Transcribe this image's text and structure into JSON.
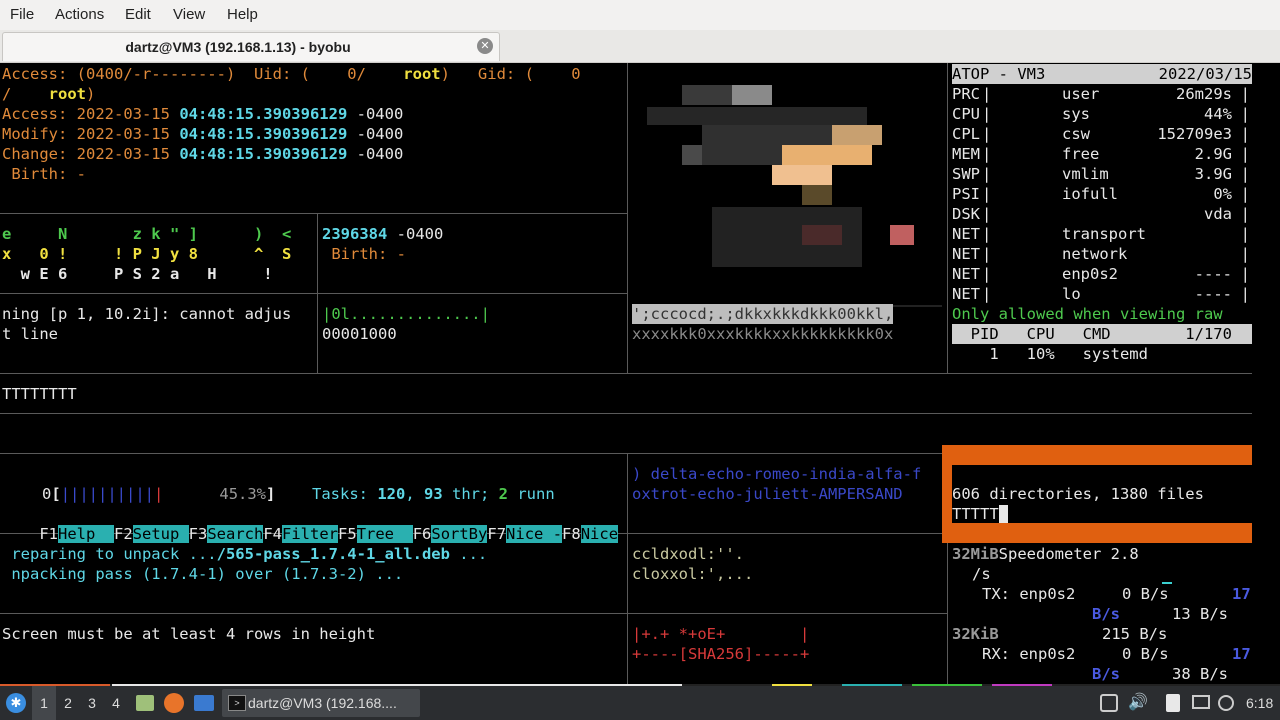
{
  "menubar": [
    "File",
    "Actions",
    "Edit",
    "View",
    "Help"
  ],
  "tab": {
    "title": "dartz@VM3 (192.168.1.13) - byobu"
  },
  "stat": {
    "access_perm": "Access: (0400/-r--------)  Uid: (    0/    ",
    "root1": "root",
    "gid": ")   Gid: (    0",
    "slash": "/    ",
    "root2": "root",
    "close": ")",
    "access_label": "Access: 2022-03-15 ",
    "access_time": "04:48:15.390396129",
    "access_tz": " -0400",
    "modify_label": "Modify: 2022-03-15 ",
    "modify_time": "04:48:15.390396129",
    "modify_tz": " -0400",
    "change_label": "Change: 2022-03-15 ",
    "change_time": "04:48:15.390396129",
    "change_tz": " -0400",
    "birth": " Birth: -"
  },
  "glyphs": {
    "l1": "e     N       z k \" ]      )  <",
    "l2": "x   0 !     ! P J y 8      ^  S",
    "l3": "  w E 6     P S 2 a   H     !"
  },
  "stat2": {
    "time": "2396384",
    "tz": " -0400",
    "birth": " Birth: -"
  },
  "apt_err": {
    "l1": "ning [p 1, 10.2i]: cannot adjus",
    "l2": "t line"
  },
  "hexdump": {
    "l1": "|0l..............|",
    "l2": "00001000"
  },
  "art": {
    "l1": "';cccocd;.;dkkxkkkdkkk00kkl,",
    "l2": "xxxxkkk0xxxkkkkxxkkkkkkkkk0x"
  },
  "atop": {
    "header_name": "ATOP - VM3",
    "header_date": "2022/03/15",
    "rows": [
      {
        "k": "PRC",
        "label": "user",
        "value": "26m29s"
      },
      {
        "k": "CPU",
        "label": "sys",
        "value": "44%"
      },
      {
        "k": "CPL",
        "label": "csw",
        "value": "152709e3"
      },
      {
        "k": "MEM",
        "label": "free",
        "value": "2.9G"
      },
      {
        "k": "SWP",
        "label": "vmlim",
        "value": "3.9G"
      },
      {
        "k": "PSI",
        "label": "iofull",
        "value": "0%"
      },
      {
        "k": "DSK",
        "label": "",
        "value": "vda"
      },
      {
        "k": "NET",
        "label": "transport",
        "value": ""
      },
      {
        "k": "NET",
        "label": "network",
        "value": ""
      },
      {
        "k": "NET",
        "label": "enp0s2",
        "value": "----"
      },
      {
        "k": "NET",
        "label": "lo",
        "value": "----"
      }
    ],
    "note": "Only allowed when viewing raw",
    "proc_header": "  PID   CPU   CMD        1/170",
    "proc_row": "    1   10%   systemd"
  },
  "tline": "TTTTTTTT",
  "htop": {
    "cpu_label": "0",
    "cpu_open": "[",
    "cpu_bars": "||||||||||",
    "cpu_pct": "45.3%",
    "cpu_close": "]",
    "tasks_label": "Tasks: ",
    "tasks": "120",
    ", ": ", ",
    "thr": "93",
    " thr; ": " thr; ",
    "run": "2",
    " runn": " runn",
    "fkeys": [
      [
        "F1",
        "Help  "
      ],
      [
        "F2",
        "Setup "
      ],
      [
        "F3",
        "Search"
      ],
      [
        "F4",
        "Filter"
      ],
      [
        "F5",
        "Tree  "
      ],
      [
        "F6",
        "SortBy"
      ],
      [
        "F7",
        "Nice -"
      ],
      [
        "F8",
        "Nice"
      ]
    ]
  },
  "apt": {
    "l1a": " reparing to unpack ...",
    "l1b": "/565-pass_1.7.4-1_all.deb",
    " l1c": " ...",
    "l2": " npacking pass (1.7.4-1) over (1.7.3-2) ..."
  },
  "phonetic": {
    "l1": ") delta-echo-romeo-india-alfa-f",
    "l2": "oxtrot-echo-juliett-AMPERSAND"
  },
  "tree": {
    "summary": "606 directories, 1380 files",
    "cursor_line": "TTTTT"
  },
  "cclines": {
    "l1": "ccldxodl:''.",
    "l2": "cloxxol:',..."
  },
  "screen_msg": "Screen must be at least 4 rows in height",
  "sha": {
    "l1": "|+.+ *+oE+        |",
    "l2": "+----[SHA256]-----+"
  },
  "speed": {
    "title": "Speedometer 2.8",
    "top_scale": "32MiB",
    "unit": "/s",
    "tx": "TX: enp0s2     0 B/s",
    "tx_peak": "17",
    "tx_peak_unit": "B/s",
    "tx_avg": "13 B/s",
    "mid_scale": "32KiB",
    "mid_val": "215 B/s",
    "rx": "RX: enp0s2     0 B/s",
    "rx_peak": "17",
    "rx_peak_unit": "B/s",
    "rx_avg": "38 B/s"
  },
  "taskbar": {
    "workspaces": [
      "1",
      "2",
      "3",
      "4"
    ],
    "window": "dartz@VM3 (192.168....",
    "clock": "6:18"
  }
}
